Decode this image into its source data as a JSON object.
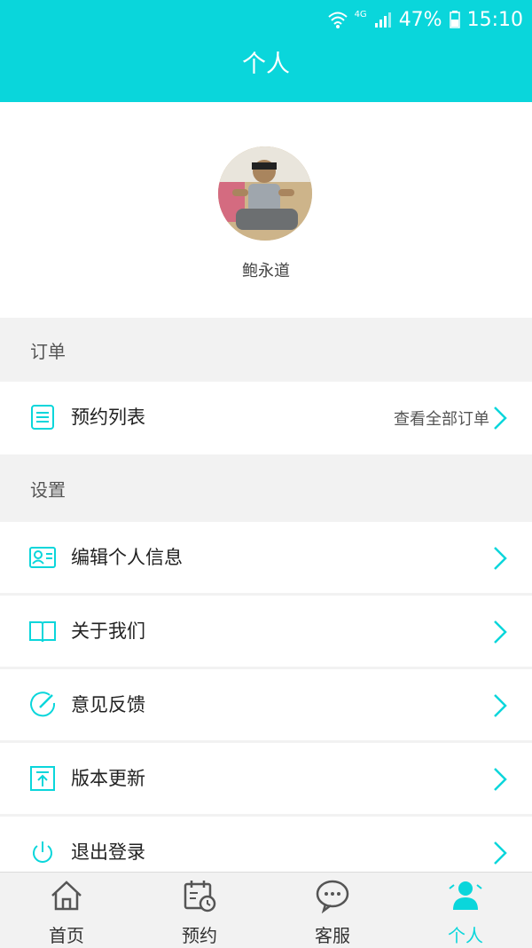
{
  "status_bar": {
    "network": "4G",
    "battery": "47%",
    "time": "15:10"
  },
  "header": {
    "title": "个人"
  },
  "profile": {
    "username": "鲍永道"
  },
  "sections": {
    "order": {
      "title": "订单",
      "item_label": "预约列表",
      "item_action": "查看全部订单"
    },
    "settings": {
      "title": "设置",
      "items": [
        {
          "label": "编辑个人信息",
          "icon": "profile-card-icon"
        },
        {
          "label": "关于我们",
          "icon": "book-icon"
        },
        {
          "label": "意见反馈",
          "icon": "feedback-icon"
        },
        {
          "label": "版本更新",
          "icon": "upload-icon"
        },
        {
          "label": "退出登录",
          "icon": "power-icon"
        }
      ]
    }
  },
  "tabs": [
    {
      "label": "首页",
      "icon": "home-icon"
    },
    {
      "label": "预约",
      "icon": "calendar-clock-icon"
    },
    {
      "label": "客服",
      "icon": "chat-bubble-icon"
    },
    {
      "label": "个人",
      "icon": "user-icon",
      "active": true
    }
  ],
  "colors": {
    "accent": "#0ad6db",
    "background": "#f2f2f2",
    "text": "#222222"
  }
}
